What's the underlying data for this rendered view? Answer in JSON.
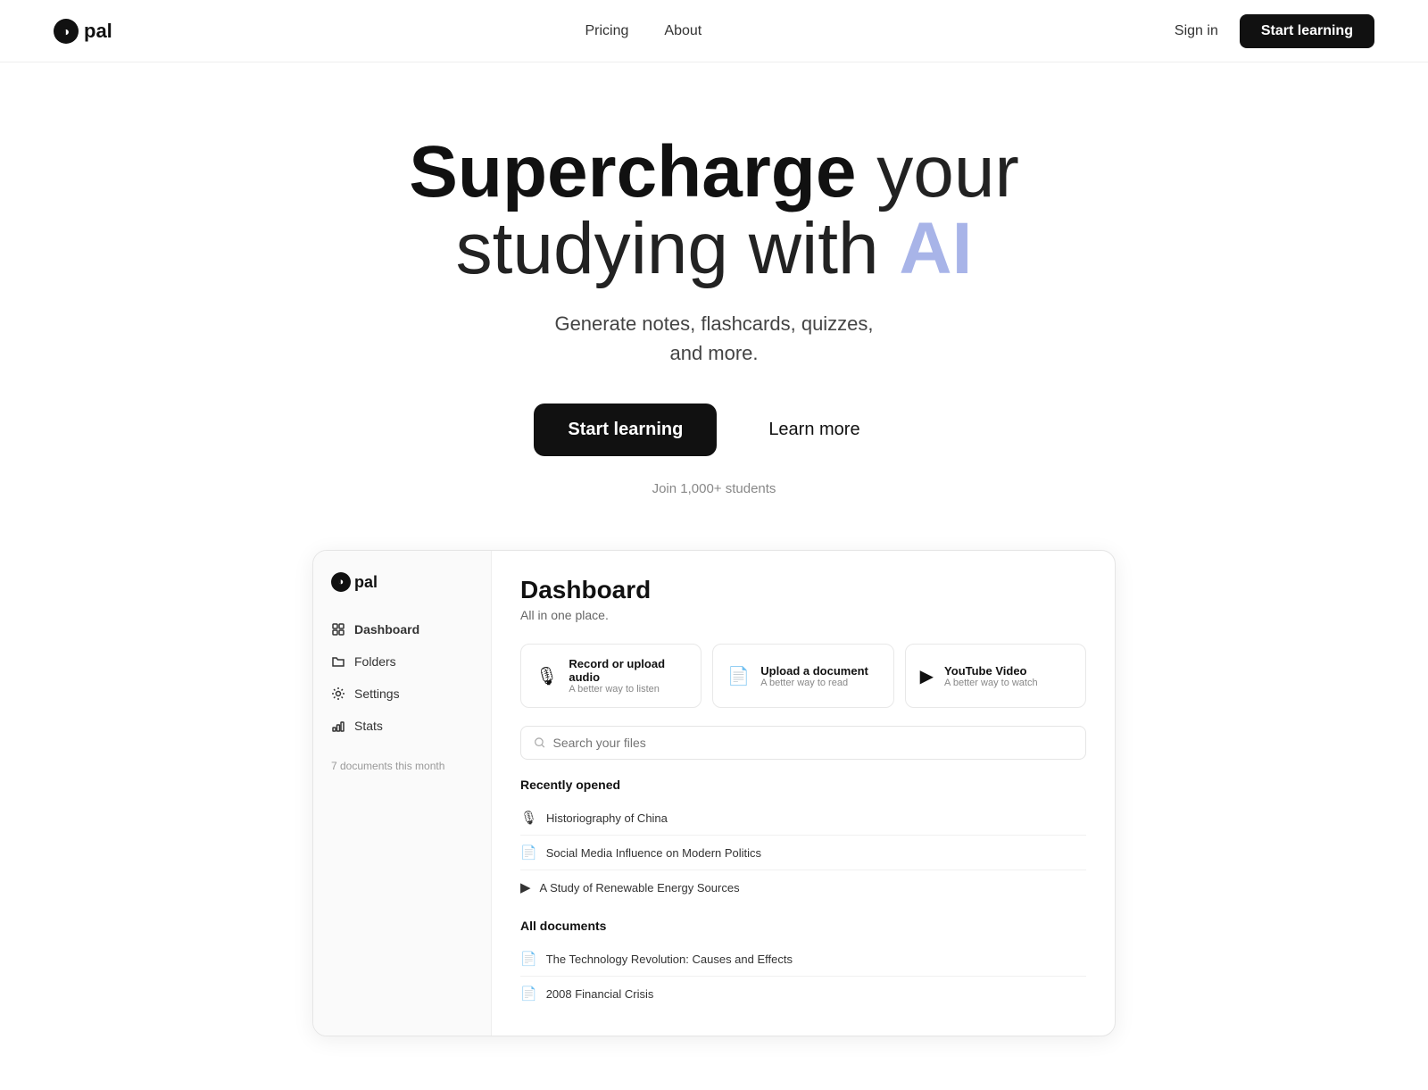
{
  "nav": {
    "logo_text": "pal",
    "links": [
      {
        "label": "Pricing",
        "id": "pricing"
      },
      {
        "label": "About",
        "id": "about"
      }
    ],
    "signin_label": "Sign in",
    "cta_label": "Start learning"
  },
  "hero": {
    "title_bold": "Supercharge",
    "title_normal": " your studying with ",
    "title_ai": "AI",
    "subtitle_line1": "Generate notes, flashcards, quizzes,",
    "subtitle_line2": "and more.",
    "btn_primary": "Start learning",
    "btn_secondary": "Learn more",
    "social_proof": "Join 1,000+ students"
  },
  "dashboard": {
    "title": "Dashboard",
    "subtitle": "All in one place.",
    "upload_cards": [
      {
        "icon": "🎙",
        "label": "Record or upload audio",
        "sublabel": "A better way to listen"
      },
      {
        "icon": "📄",
        "label": "Upload a document",
        "sublabel": "A better way to read"
      },
      {
        "icon": "▶",
        "label": "YouTube Video",
        "sublabel": "A better way to watch"
      }
    ],
    "search_placeholder": "Search your files",
    "recently_opened_label": "Recently opened",
    "recent_files": [
      {
        "icon": "🎙",
        "name": "Historiography of China"
      },
      {
        "icon": "📄",
        "name": "Social Media Influence on Modern Politics"
      },
      {
        "icon": "▶",
        "name": "A Study of Renewable Energy Sources"
      }
    ],
    "all_documents_label": "All documents",
    "all_documents": [
      {
        "icon": "📄",
        "name": "The Technology Revolution: Causes and Effects"
      },
      {
        "icon": "📄",
        "name": "2008 Financial Crisis"
      }
    ],
    "footer_text": "7 documents this month"
  },
  "sidebar": {
    "logo": "pal",
    "items": [
      {
        "label": "Dashboard",
        "active": true
      },
      {
        "label": "Folders",
        "active": false
      },
      {
        "label": "Settings",
        "active": false
      },
      {
        "label": "Stats",
        "active": false
      }
    ]
  }
}
